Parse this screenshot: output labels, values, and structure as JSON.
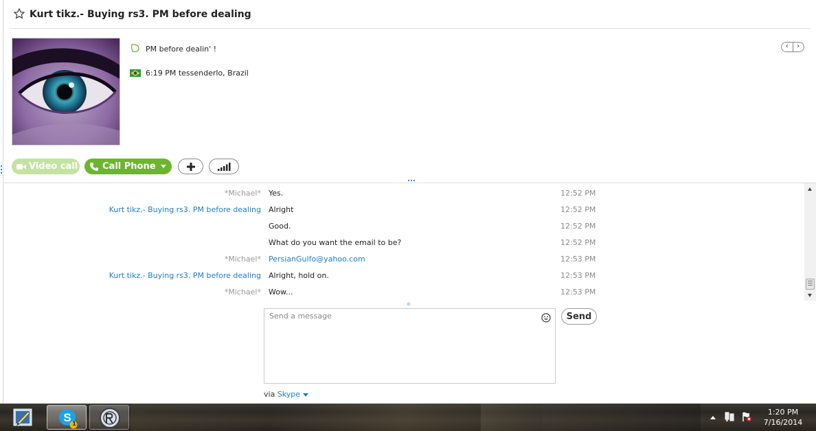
{
  "header": {
    "title": "Kurt tikz.- Buying rs3. PM before dealing",
    "icons": {
      "favorite": "star-outline-icon"
    }
  },
  "profile": {
    "mood": "PM before dealin' !",
    "location": "6:19 PM tessenderlo, Brazil",
    "nav_prev": "‹",
    "nav_next": "›"
  },
  "actions": {
    "video_call": "Video call",
    "call_phone": "Call Phone"
  },
  "messages": [
    {
      "sender": "*Michael*",
      "sender_type": "me",
      "text": "Yes.",
      "time": "12:52 PM"
    },
    {
      "sender": "Kurt tikz.- Buying rs3. PM before dealing",
      "sender_type": "other",
      "text": "Alright",
      "time": "12:52 PM"
    },
    {
      "sender": "",
      "sender_type": "other",
      "text": "Good.",
      "time": "12:52 PM"
    },
    {
      "sender": "",
      "sender_type": "other",
      "text": "What do you want the email to be?",
      "time": "12:52 PM"
    },
    {
      "sender": "*Michael*",
      "sender_type": "me",
      "text": "PersianGulfo@yahoo.com",
      "text_type": "link",
      "time": "12:53 PM"
    },
    {
      "sender": "Kurt tikz.- Buying rs3. PM before dealing",
      "sender_type": "other",
      "text": "Alright, hold on.",
      "time": "12:53 PM"
    },
    {
      "sender": "*Michael*",
      "sender_type": "me",
      "text": "Wow...",
      "time": "12:53 PM"
    }
  ],
  "composer": {
    "placeholder": "Send a message",
    "send_label": "Send",
    "via_prefix": "via",
    "via_service": "Skype"
  },
  "taskbar": {
    "time": "1:20 PM",
    "date": "7/16/2014",
    "skype_badge": "1"
  },
  "colors": {
    "accent_green": "#6cb52d",
    "disabled_green": "#c4e2a3",
    "link_blue": "#1f7bc6"
  }
}
